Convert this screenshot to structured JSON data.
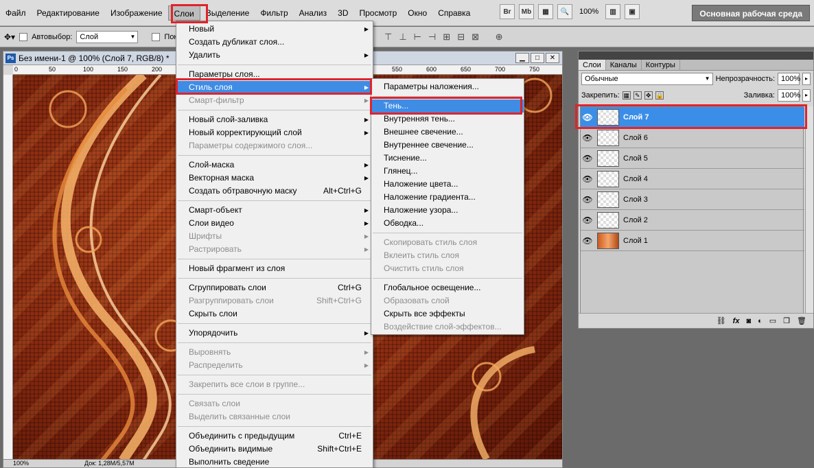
{
  "menubar": {
    "items": [
      "Файл",
      "Редактирование",
      "Изображение",
      "Слои",
      "Выделение",
      "Фильтр",
      "Анализ",
      "3D",
      "Просмотр",
      "Окно",
      "Справка"
    ],
    "icons": [
      "Br",
      "Mb"
    ],
    "zoom": "100%",
    "workspace": "Основная рабочая среда"
  },
  "optbar": {
    "autoselect_label": "Автовыбор:",
    "autoselect_value": "Слой",
    "show_label": "Показ"
  },
  "document": {
    "title": "Без имени-1 @ 100% (Слой 7, RGB/8) *",
    "ps": "Ps",
    "ruler_ticks": [
      "0",
      "50",
      "100",
      "150",
      "200",
      "550",
      "600",
      "650",
      "700",
      "750"
    ],
    "status_zoom": "100%",
    "status_doc": "Док: 1,28M/5,57M"
  },
  "layers_menu": {
    "items": [
      {
        "label": "Новый",
        "arrow": true
      },
      {
        "label": "Создать дубликат слоя..."
      },
      {
        "label": "Удалить",
        "arrow": true
      },
      {
        "sep": true
      },
      {
        "label": "Параметры слоя..."
      },
      {
        "label": "Стиль слоя",
        "arrow": true,
        "highlight": true
      },
      {
        "label": "Смарт-фильтр",
        "arrow": true,
        "disabled": true
      },
      {
        "sep": true
      },
      {
        "label": "Новый слой-заливка",
        "arrow": true
      },
      {
        "label": "Новый корректирующий слой",
        "arrow": true
      },
      {
        "label": "Параметры содержимого слоя...",
        "disabled": true
      },
      {
        "sep": true
      },
      {
        "label": "Слой-маска",
        "arrow": true
      },
      {
        "label": "Векторная маска",
        "arrow": true
      },
      {
        "label": "Создать обтравочную маску",
        "shortcut": "Alt+Ctrl+G"
      },
      {
        "sep": true
      },
      {
        "label": "Смарт-объект",
        "arrow": true
      },
      {
        "label": "Слои видео",
        "arrow": true
      },
      {
        "label": "Шрифты",
        "arrow": true,
        "disabled": true
      },
      {
        "label": "Растрировать",
        "arrow": true,
        "disabled": true
      },
      {
        "sep": true
      },
      {
        "label": "Новый фрагмент из слоя"
      },
      {
        "sep": true
      },
      {
        "label": "Сгруппировать слои",
        "shortcut": "Ctrl+G"
      },
      {
        "label": "Разгруппировать слои",
        "shortcut": "Shift+Ctrl+G",
        "disabled": true
      },
      {
        "label": "Скрыть слои"
      },
      {
        "sep": true
      },
      {
        "label": "Упорядочить",
        "arrow": true
      },
      {
        "sep": true
      },
      {
        "label": "Выровнять",
        "arrow": true,
        "disabled": true
      },
      {
        "label": "Распределить",
        "arrow": true,
        "disabled": true
      },
      {
        "sep": true
      },
      {
        "label": "Закрепить все слои в группе...",
        "disabled": true
      },
      {
        "sep": true
      },
      {
        "label": "Связать слои",
        "disabled": true
      },
      {
        "label": "Выделить связанные слои",
        "disabled": true
      },
      {
        "sep": true
      },
      {
        "label": "Объединить с предыдущим",
        "shortcut": "Ctrl+E"
      },
      {
        "label": "Объединить видимые",
        "shortcut": "Shift+Ctrl+E"
      },
      {
        "label": "Выполнить сведение"
      }
    ]
  },
  "style_menu": {
    "items": [
      {
        "label": "Параметры наложения..."
      },
      {
        "sep": true
      },
      {
        "label": "Тень...",
        "highlight": true
      },
      {
        "label": "Внутренняя тень..."
      },
      {
        "label": "Внешнее свечение..."
      },
      {
        "label": "Внутреннее свечение..."
      },
      {
        "label": "Тиснение..."
      },
      {
        "label": "Глянец..."
      },
      {
        "label": "Наложение цвета..."
      },
      {
        "label": "Наложение градиента..."
      },
      {
        "label": "Наложение узора..."
      },
      {
        "label": "Обводка..."
      },
      {
        "sep": true
      },
      {
        "label": "Скопировать стиль слоя",
        "disabled": true
      },
      {
        "label": "Вклеить стиль слоя",
        "disabled": true
      },
      {
        "label": "Очистить стиль слоя",
        "disabled": true
      },
      {
        "sep": true
      },
      {
        "label": "Глобальное освещение..."
      },
      {
        "label": "Образовать слой",
        "disabled": true
      },
      {
        "label": "Скрыть все эффекты"
      },
      {
        "label": "Воздействие слой-эффектов...",
        "disabled": true
      }
    ]
  },
  "panel": {
    "tabs": [
      "Слои",
      "Каналы",
      "Контуры"
    ],
    "blend_mode": "Обычные",
    "opacity_label": "Непрозрачность:",
    "opacity_value": "100%",
    "lock_label": "Закрепить:",
    "fill_label": "Заливка:",
    "fill_value": "100%",
    "layers": [
      "Слой 7",
      "Слой 6",
      "Слой 5",
      "Слой 4",
      "Слой 3",
      "Слой 2",
      "Слой 1"
    ],
    "selected_layer": 0,
    "bottom_icons": [
      "link-icon",
      "fx-icon",
      "mask-icon",
      "adjust-icon",
      "folder-icon",
      "new-layer-icon",
      "trash-icon"
    ],
    "fx_text": "fx"
  },
  "colors": {
    "highlight": "#3f8ce5",
    "annotation": "#e0232b",
    "selected_layer": "#3b8ee8"
  }
}
